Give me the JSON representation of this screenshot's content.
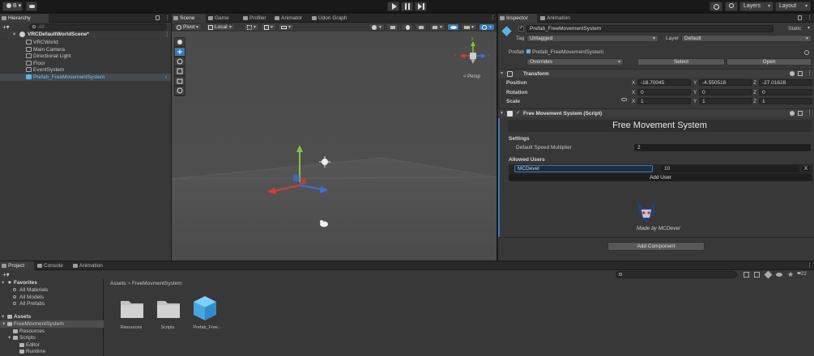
{
  "toolbar": {
    "account_label": "B",
    "dropdown_caret": "▾",
    "layers_label": "Layers",
    "layout_label": "Layout"
  },
  "hierarchy": {
    "tab_label": "Hierarchy",
    "search_placeholder": "All",
    "scene_name": "VRCDefaultWorldScene*",
    "items": [
      "VRCWorld",
      "Main Camera",
      "Directional Light",
      "Floor",
      "EventSystem",
      "Prefab_FreeMovementSystem"
    ]
  },
  "scene": {
    "tabs": [
      "Scene",
      "Game",
      "Profiler",
      "Animator",
      "Udon Graph"
    ],
    "pivot_label": "Pivot",
    "local_label": "Local",
    "persp_label": "< Persp",
    "gizmo_x": "x",
    "gizmo_z": "z",
    "gizmo_y": "y"
  },
  "inspector": {
    "tabs": [
      "Inspector",
      "Animation"
    ],
    "object_name": "Prefab_FreeMovementSystem",
    "static_label": "Static",
    "tag_label": "Tag",
    "tag_value": "Untagged",
    "layer_label": "Layer",
    "layer_value": "Default",
    "prefab_label": "Prefab",
    "prefab_value": "Prefab_FreeMovementSystem",
    "overrides_label": "Overrides",
    "select_label": "Select",
    "open_label": "Open",
    "transform": {
      "title": "Transform",
      "rows": [
        {
          "label": "Position",
          "x": "-18.70045",
          "y": "-4.550518",
          "z": "-27.01628"
        },
        {
          "label": "Rotation",
          "x": "0",
          "y": "0",
          "z": "0"
        },
        {
          "label": "Scale",
          "x": "1",
          "y": "1",
          "z": "1"
        }
      ],
      "axis_x": "X",
      "axis_y": "Y",
      "axis_z": "Z"
    },
    "script": {
      "title": "Free Movement System (Script)",
      "header": "Free Movement System",
      "settings_label": "Settings",
      "speed_label": "Default Speed Multiplier",
      "speed_value": "2",
      "allowed_label": "Allowed Users",
      "user_name": "MCDevel",
      "user_speed": "10",
      "remove_label": "X",
      "add_user_label": "Add User",
      "credit": "Made by MCDevel"
    },
    "add_component_label": "Add Component"
  },
  "project": {
    "tabs": [
      "Project",
      "Console",
      "Animation"
    ],
    "favorites_label": "Favorites",
    "favorites": [
      "All Materials",
      "All Models",
      "All Prefabs"
    ],
    "assets_label": "Assets",
    "tree": [
      "FreeMovmentSystem",
      "Resources",
      "Scripts",
      "Editor",
      "Runtime"
    ],
    "breadcrumb_root": "Assets",
    "breadcrumb_sep": ">",
    "breadcrumb_folder": "FreeMovmentSystem",
    "grid_items": [
      "Resources",
      "Scripts",
      "Prefab_Free..."
    ],
    "hidden_count": "22"
  },
  "colors": {
    "accent_blue": "#3a79bb",
    "gizmo_x": "#db3b3b",
    "gizmo_y": "#86c440",
    "gizmo_z": "#3a6fe0"
  }
}
